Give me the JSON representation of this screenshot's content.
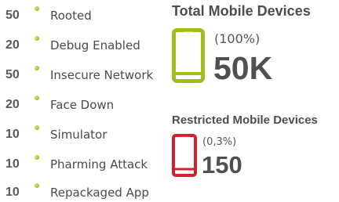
{
  "risk_items": [
    {
      "count": "50",
      "label": "Rooted"
    },
    {
      "count": "20",
      "label": "Debug Enabled"
    },
    {
      "count": "50",
      "label": "Insecure Network"
    },
    {
      "count": "20",
      "label": "Face Down"
    },
    {
      "count": "10",
      "label": "Simulator"
    },
    {
      "count": "10",
      "label": "Pharming Attack"
    },
    {
      "count": "10",
      "label": "Repackaged App"
    }
  ],
  "total": {
    "title": "Total Mobile Devices",
    "percent": "(100%)",
    "value": "50K",
    "icon": "mobile-phone-icon",
    "color": "#a3bd1c"
  },
  "restricted": {
    "title": "Restricted Mobile Devices",
    "percent": "(0,3%)",
    "value": "150",
    "icon": "mobile-phone-icon",
    "color": "#d4202c"
  },
  "bullet_color": "#a8c62a"
}
